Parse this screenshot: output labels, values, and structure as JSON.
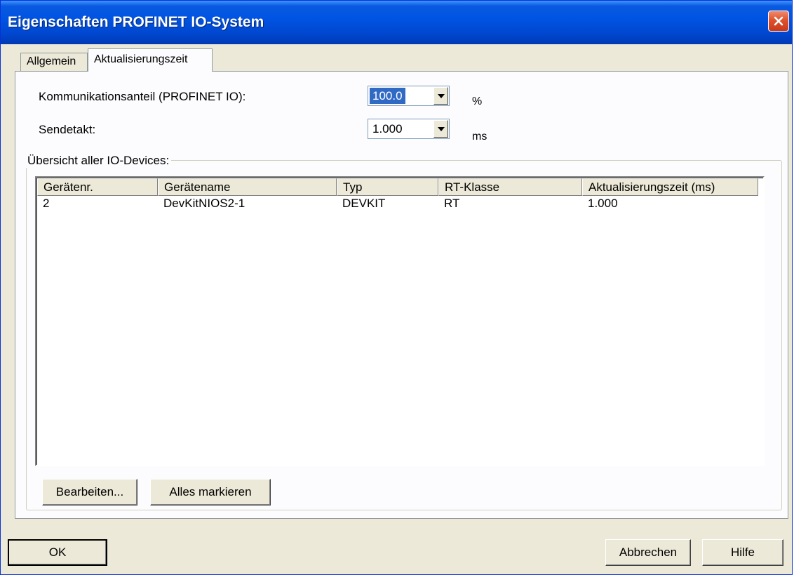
{
  "window": {
    "title": "Eigenschaften PROFINET IO-System"
  },
  "tabs": [
    {
      "label": "Allgemein",
      "active": false
    },
    {
      "label": "Aktualisierungszeit",
      "active": true
    }
  ],
  "settings": {
    "kommunikationsanteil_label": "Kommunikationsanteil (PROFINET IO):",
    "kommunikationsanteil_value": "100.0",
    "kommunikationsanteil_unit": "%",
    "sendetakt_label": "Sendetakt:",
    "sendetakt_value": "1.000",
    "sendetakt_unit": "ms"
  },
  "devices": {
    "group_label": "Übersicht aller IO-Devices:",
    "columns": [
      "Gerätenr.",
      "Gerätename",
      "Typ",
      "RT-Klasse",
      "Aktualisierungszeit (ms)"
    ],
    "rows": [
      [
        "2",
        "DevKitNIOS2-1",
        "DEVKIT",
        "RT",
        "1.000"
      ]
    ],
    "edit_button": "Bearbeiten...",
    "select_all_button": "Alles markieren"
  },
  "footer": {
    "ok": "OK",
    "cancel": "Abbrechen",
    "help": "Hilfe"
  },
  "icons": {
    "close": "close-icon",
    "dropdown": "chevron-down-icon"
  },
  "colors": {
    "titlebar": "#0054e3",
    "close_button": "#e0522e",
    "selection": "#316ac5",
    "dialog_face": "#ece9d8"
  }
}
